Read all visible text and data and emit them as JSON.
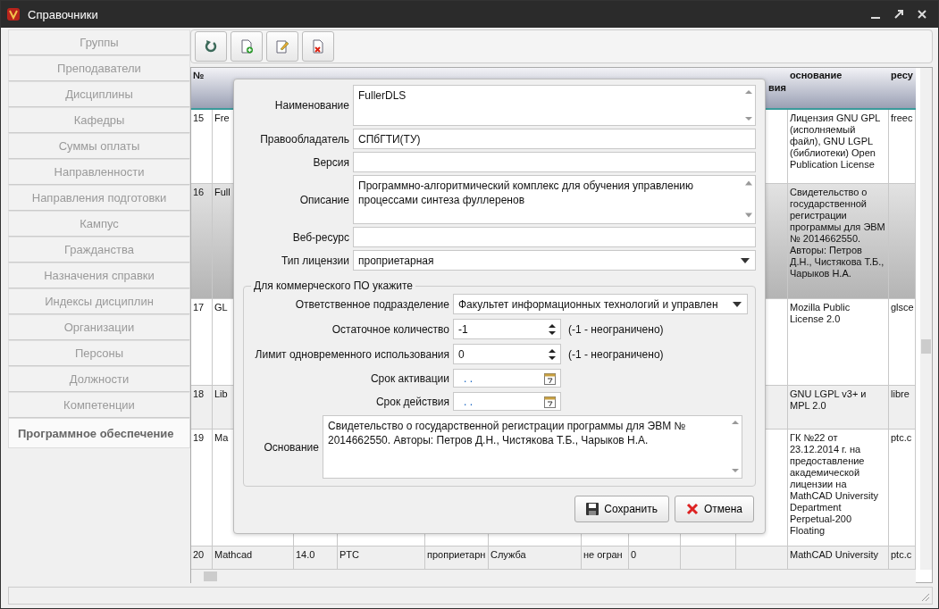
{
  "window": {
    "title": "Справочники"
  },
  "sidebar": {
    "items": [
      {
        "label": "Группы",
        "selected": false
      },
      {
        "label": "Преподаватели",
        "selected": false
      },
      {
        "label": "Дисциплины",
        "selected": false
      },
      {
        "label": "Кафедры",
        "selected": false
      },
      {
        "label": "Суммы оплаты",
        "selected": false
      },
      {
        "label": "Направленности",
        "selected": false
      },
      {
        "label": "Направления подготовки",
        "selected": false
      },
      {
        "label": "Кампус",
        "selected": false
      },
      {
        "label": "Гражданства",
        "selected": false
      },
      {
        "label": "Назначения справки",
        "selected": false
      },
      {
        "label": "Индексы дисциплин",
        "selected": false
      },
      {
        "label": "Организации",
        "selected": false
      },
      {
        "label": "Персоны",
        "selected": false
      },
      {
        "label": "Должности",
        "selected": false
      },
      {
        "label": "Компетенции",
        "selected": false
      },
      {
        "label": "Программное обеспечение",
        "selected": true
      }
    ]
  },
  "table": {
    "header": {
      "number": "№",
      "fragment": "вия",
      "basis": "основание",
      "resource": "ресу"
    },
    "rows": [
      {
        "number": "15",
        "name": "Fre",
        "basis": "Лицензия GNU GPL (исполняемый файл), GNU LGPL (библиотеки) Open Publication License",
        "resource": "freec",
        "selected": false
      },
      {
        "number": "16",
        "name": "Full",
        "basis": "Свидетельство о государственной регистрации программы для ЭВМ № 2014662550. Авторы: Петров Д.Н., Чистякова Т.Б., Чарыков Н.А.",
        "selected": true
      },
      {
        "number": "17",
        "name": "GL",
        "basis": "Mozilla Public License 2.0",
        "resource": "glsce",
        "selected": false
      },
      {
        "number": "18",
        "name": "Lib",
        "basis": "GNU LGPL v3+ и MPL 2.0",
        "resource": "libre",
        "selected": false
      },
      {
        "number": "19",
        "name": "Ma",
        "basis": "ГК №22 от 23.12.2014 г. на предоставление академической лицензии на MathCAD University Department Perpetual-200 Floating",
        "resource": "ptc.c",
        "selected": false
      },
      {
        "number": "20",
        "name": "Mathcad",
        "middle": [
          "14.0",
          "PTC",
          "проприетарн",
          "Служба",
          "не огран",
          "0"
        ],
        "basis": "MathCAD University",
        "resource": "ptc.c",
        "selected": false
      }
    ]
  },
  "dialog": {
    "fields": [
      {
        "kind": "textarea",
        "label": "Наименование",
        "value": "FullerDLS"
      },
      {
        "kind": "text",
        "label": "Правообладатель",
        "value": "СПбГТИ(ТУ)"
      },
      {
        "kind": "text",
        "label": "Версия"
      },
      {
        "kind": "textarea",
        "label": "Описание",
        "value": "Программно-алгоритмический комплекс для обучения управлению процессами синтеза фуллеренов"
      },
      {
        "kind": "text",
        "label": "Веб-ресурс"
      },
      {
        "kind": "select",
        "label": "Тип лицензии",
        "value": "проприетарная"
      }
    ],
    "group": {
      "title": "Для коммерческого ПО укажите",
      "fields": [
        {
          "kind": "select",
          "label": "Ответственное подразделение",
          "value": "Факультет информационных технологий и управлен"
        },
        {
          "kind": "spin",
          "label": "Остаточное количество",
          "value": "-1",
          "hint": "(-1 - неограничено)"
        },
        {
          "kind": "spin",
          "label": "Лимит одновременного использования",
          "value": "0",
          "hint": "(-1 - неограничено)"
        },
        {
          "kind": "date",
          "label": "Срок активации",
          "value": ". ."
        },
        {
          "kind": "date",
          "label": "Срок действия",
          "value": ". ."
        }
      ],
      "basis": {
        "label": "Основание",
        "value": "Свидетельство о государственной регистрации программы для ЭВМ № 2014662550. Авторы: Петров Д.Н., Чистякова Т.Б., Чарыков Н.А."
      }
    },
    "buttons": [
      {
        "kind": "save",
        "label": "Сохранить"
      },
      {
        "kind": "cancel",
        "label": "Отмена"
      }
    ]
  }
}
